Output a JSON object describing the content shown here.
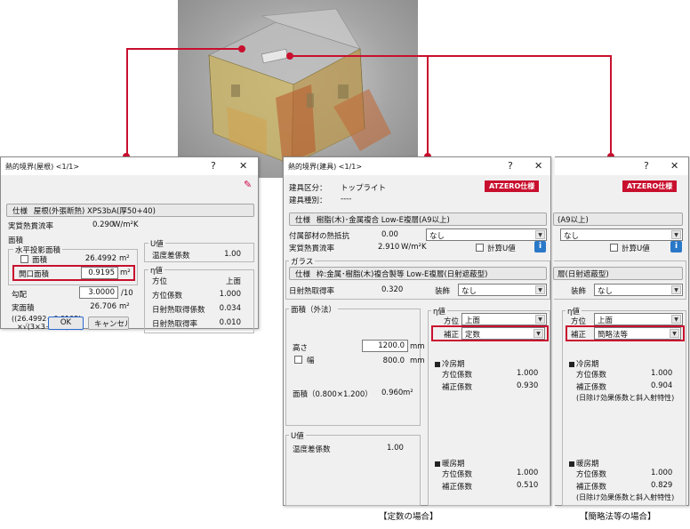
{
  "model_view": {
    "bg_color": "#9a9a9a"
  },
  "roof_dialog": {
    "title": "熱的境界(屋根) <1/1>",
    "help": "?",
    "close": "✕",
    "spec_label": "仕様",
    "spec_value": "屋根(外張断熱) XPS3bA(厚50+40)",
    "u_label": "実質熱貫流率",
    "u_value": "0.290",
    "u_unit": "W/m²K",
    "area_group": "面積",
    "horiz_group": "水平投影面積",
    "area_label": "面積",
    "area_value": "26.4992",
    "area_unit": "m²",
    "opening_label": "開口面積",
    "opening_value": "0.9195",
    "opening_unit": "m²",
    "slope_label": "勾配",
    "slope_value": "3.0000",
    "slope_unit": "/10",
    "real_area_label": "実面積",
    "real_area_value": "26.706",
    "real_area_unit": "m²",
    "formula1": "((26.4992－0.9195)",
    "formula2": "×√(3×3＋100)/10)",
    "uval_group": "U値",
    "temp_label": "温度差係数",
    "temp_value": "1.00",
    "eta_group": "η値",
    "dir_label": "方位",
    "dir_value": "上面",
    "dircoef_label": "方位係数",
    "dircoef_value": "1.000",
    "solar1_label": "日射熱取得係数",
    "solar1_value": "0.034",
    "solar2_label": "日射熱取得率",
    "solar2_value": "0.010",
    "ok": "OK",
    "cancel": "キャンセル"
  },
  "window_dialog": {
    "title": "熱的境界(建具) <1/1>",
    "help": "?",
    "close": "✕",
    "tag": "ATZERO仕様",
    "kind_label": "建具区分：",
    "kind_value": "トップライト",
    "type_label": "建具種別：",
    "type_value": "----",
    "spec_label": "仕様",
    "spec_value": "樹脂(木)･金属複合 Low-E複層(A9以上)",
    "attach_label": "付属部材の熱抵抗",
    "attach_value": "0.00",
    "attach_select": "なし",
    "u_label": "実質熱貫流率",
    "u_value": "2.910",
    "u_unit": "W/m²K",
    "calc_u": "計算U値",
    "glass_group": "ガラス",
    "glass_spec_label": "仕様",
    "glass_spec_value": "枠:金属･樹脂(木)複合製等 Low-E複層(日射遮蔽型)",
    "solar_label": "日射熱取得率",
    "solar_value": "0.320",
    "deco_label": "装飾",
    "deco_value": "なし",
    "area_group": "面積（外法）",
    "height_label": "高さ",
    "height_value": "1200.0",
    "height_unit": "mm",
    "width_label": "幅",
    "width_value": "800.0",
    "width_unit": "mm",
    "area_formula": "面積（0.800×1.200）",
    "area_value": "0.960",
    "area_unit": "m²",
    "uval_group": "U値",
    "temp_label": "温度差係数",
    "temp_value": "1.00",
    "eta_group": "η値",
    "dir_label": "方位",
    "dir_value": "上面",
    "corr_label": "補正",
    "corr_value": "定数",
    "cool_label": "冷房期",
    "dircoef_label": "方位係数",
    "cool_dir_value": "1.000",
    "corrcoef_label": "補正係数",
    "cool_corr_value": "0.930",
    "warm_label": "暖房期",
    "warm_dir_value": "1.000",
    "warm_corr_value": "0.510",
    "caption": "【定数の場合】"
  },
  "partial_dialog": {
    "help": "?",
    "close": "✕",
    "tag": "ATZERO仕様",
    "spec_tail": "(A9以上)",
    "attach_select": "なし",
    "calc_u": "計算U値",
    "glass_tail": "層(日射遮蔽型)",
    "deco_label": "装飾",
    "deco_value": "なし",
    "eta_group": "η値",
    "dir_label": "方位",
    "dir_value": "上面",
    "corr_label": "補正",
    "corr_value": "簡略法等",
    "cool_label": "冷房期",
    "dircoef_label": "方位係数",
    "cool_dir_value": "1.000",
    "corrcoef_label": "補正係数",
    "cool_corr_value": "0.904",
    "cool_note": "(日除け効果係数と斜入射特性)",
    "warm_label": "暖房期",
    "warm_dir_value": "1.000",
    "warm_corr_value": "0.829",
    "warm_note": "(日除け効果係数と斜入射特性)",
    "caption": "【簡略法等の場合】"
  },
  "colors": {
    "accent": "#c8102e",
    "dialog_bg": "#f0f0f0"
  }
}
